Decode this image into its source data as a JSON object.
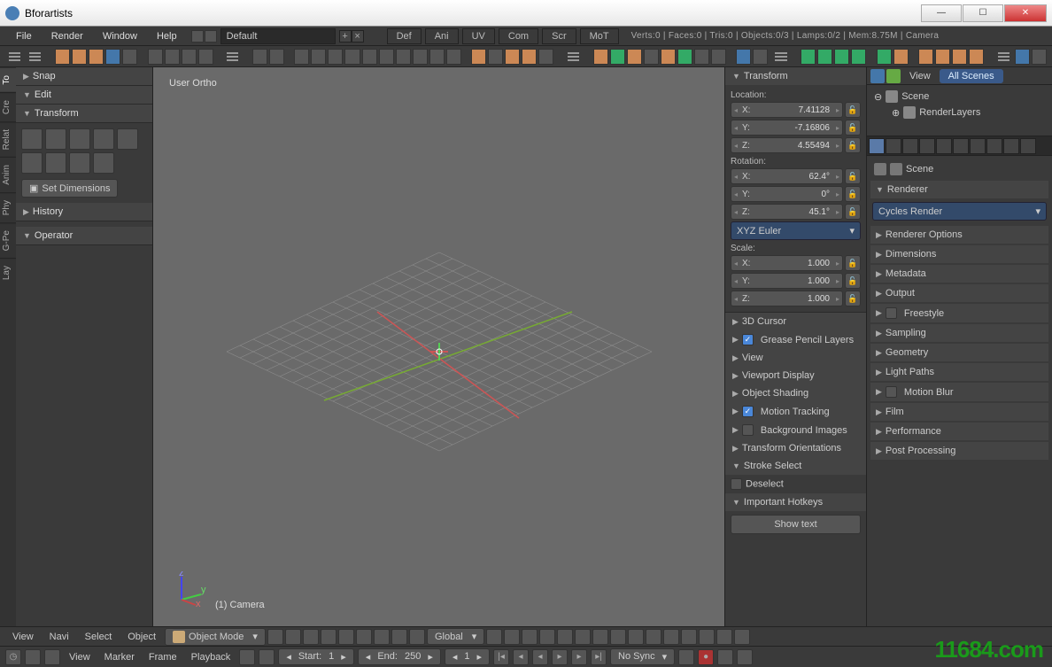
{
  "window": {
    "title": "Bforartists"
  },
  "menubar": {
    "items": [
      "File",
      "Render",
      "Window",
      "Help"
    ],
    "layout": "Default",
    "tabs": [
      "Def",
      "Ani",
      "UV",
      "Com",
      "Scr",
      "MoT"
    ],
    "stats": "Verts:0 | Faces:0 | Tris:0 | Objects:0/3 | Lamps:0/2 | Mem:8.75M | Camera"
  },
  "vtabs": [
    "To",
    "Cre",
    "Relat",
    "Anim",
    "Phy",
    "G-Pe",
    "Lay"
  ],
  "leftpanel": {
    "snap": "Snap",
    "edit": "Edit",
    "transform": "Transform",
    "setdim": "Set Dimensions",
    "history": "History",
    "operator": "Operator"
  },
  "viewport": {
    "label": "User Ortho",
    "camera": "(1) Camera"
  },
  "npanel": {
    "transform": "Transform",
    "location": "Location:",
    "loc": {
      "x": "7.41128",
      "y": "-7.16806",
      "z": "4.55494"
    },
    "rotation": "Rotation:",
    "rot": {
      "x": "62.4°",
      "y": "0°",
      "z": "45.1°"
    },
    "euler": "XYZ Euler",
    "scale": "Scale:",
    "scl": {
      "x": "1.000",
      "y": "1.000",
      "z": "1.000"
    },
    "sections": {
      "cursor": "3D Cursor",
      "grease": "Grease Pencil Layers",
      "view": "View",
      "vpdisplay": "Viewport Display",
      "shading": "Object Shading",
      "tracking": "Motion Tracking",
      "bgimg": "Background Images",
      "torient": "Transform Orientations",
      "stroke": "Stroke Select",
      "deselect": "Deselect",
      "hotkeys": "Important Hotkeys",
      "showtext": "Show text"
    }
  },
  "outliner": {
    "view": "View",
    "allscenes": "All Scenes",
    "scene": "Scene",
    "renderlayers": "RenderLayers"
  },
  "props": {
    "scenelabel": "Scene",
    "renderer": "Renderer",
    "engine": "Cycles Render",
    "panels": [
      "Renderer Options",
      "Dimensions",
      "Metadata",
      "Output",
      "Freestyle",
      "Sampling",
      "Geometry",
      "Light Paths",
      "Motion Blur",
      "Film",
      "Performance",
      "Post Processing"
    ]
  },
  "vpfooter": {
    "items": [
      "View",
      "Navi",
      "Select",
      "Object"
    ],
    "mode": "Object Mode",
    "global": "Global"
  },
  "timeline": {
    "items": [
      "View",
      "Marker",
      "Frame",
      "Playback"
    ],
    "start": "Start:",
    "startval": "1",
    "end": "End:",
    "endval": "250",
    "cur": "1",
    "nosync": "No Sync"
  },
  "watermark": "11684.com"
}
